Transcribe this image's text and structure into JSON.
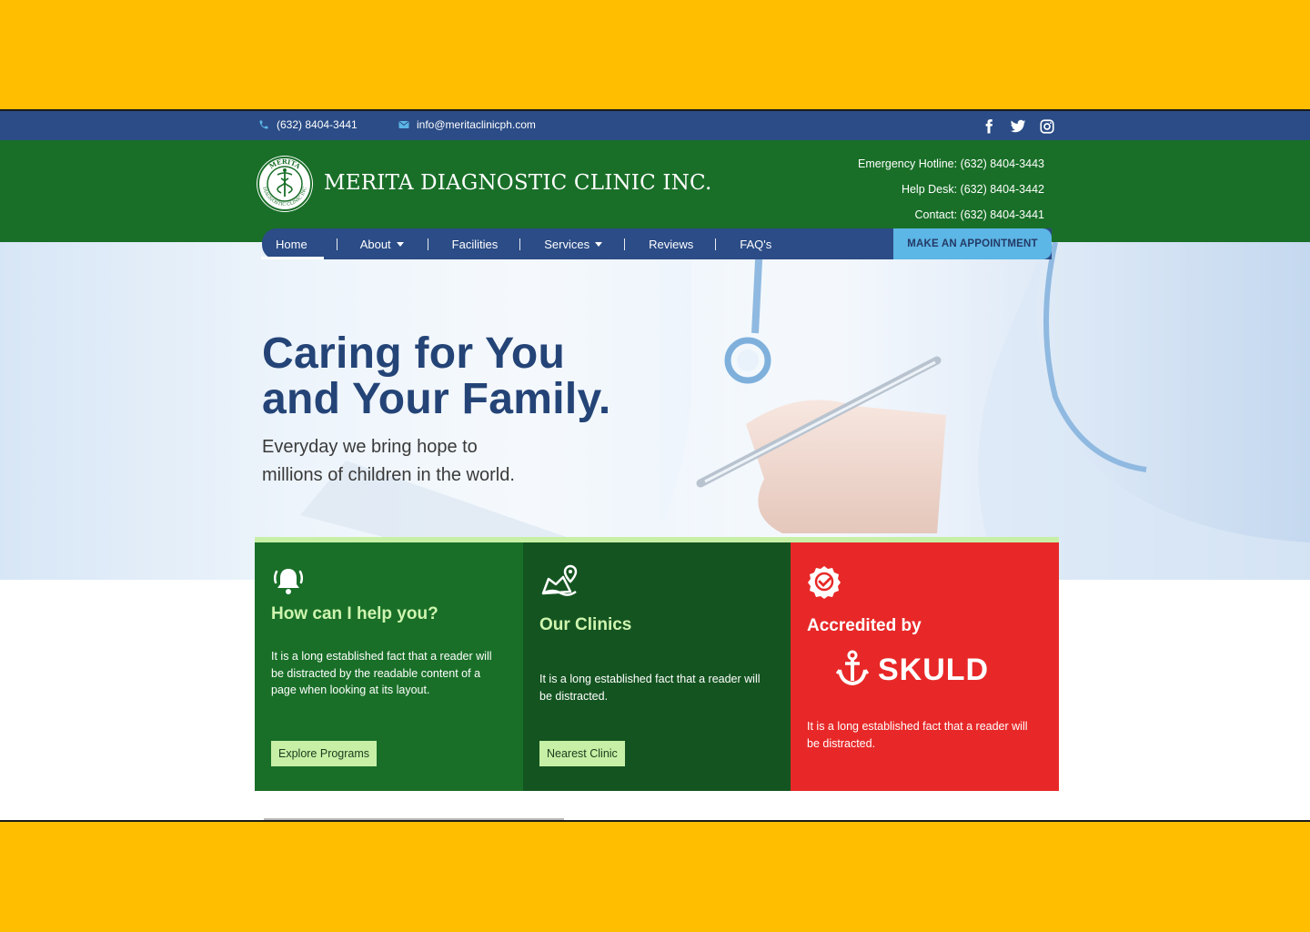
{
  "topbar": {
    "phone": "(632) 8404-3441",
    "email": "info@meritaclinicph.com",
    "social": [
      "facebook-icon",
      "twitter-icon",
      "instagram-icon"
    ]
  },
  "header": {
    "brand": "MERITA DIAGNOSTIC CLINIC INC.",
    "logo_top_text": "MERITA",
    "logo_bottom_text": "DIAGNOSTIC CLINIC INC",
    "hotlines": [
      "Emergency Hotline: (632) 8404-3443",
      "Help Desk: (632) 8404-3442",
      "Contact: (632) 8404-3441"
    ]
  },
  "nav": {
    "items": [
      {
        "label": "Home",
        "dropdown": false,
        "active": true
      },
      {
        "label": "About",
        "dropdown": true
      },
      {
        "label": "Facilities",
        "dropdown": false
      },
      {
        "label": "Services",
        "dropdown": true
      },
      {
        "label": "Reviews",
        "dropdown": false
      },
      {
        "label": "FAQ's",
        "dropdown": false
      }
    ],
    "cta": "MAKE AN APPOINTMENT"
  },
  "hero": {
    "title_line1": "Caring for You",
    "title_line2": "and Your Family.",
    "subtitle_line1": "Everyday we bring hope to",
    "subtitle_line2": "millions of children in the world."
  },
  "cards": [
    {
      "title": "How can I help you?",
      "text": "It is a long established fact that a reader will be distracted by the readable content of a page when looking at its layout.",
      "button": "Explore Programs",
      "icon": "bell-icon"
    },
    {
      "title": "Our Clinics",
      "text": "It is a long established fact that a reader will be distracted.",
      "button": "Nearest Clinic",
      "icon": "map-pin-icon"
    },
    {
      "title": "Accredited by",
      "logo_text": "SKULD",
      "text": "It is a long established fact that a reader will be distracted.",
      "icon": "badge-check-icon"
    }
  ],
  "colors": {
    "background": "#FFBF00",
    "navy": "#2B4C86",
    "green": "#196F28",
    "dark_green": "#145420",
    "red": "#E82828",
    "light_green": "#C7F0A6",
    "cta_blue": "#5CB6E6"
  }
}
